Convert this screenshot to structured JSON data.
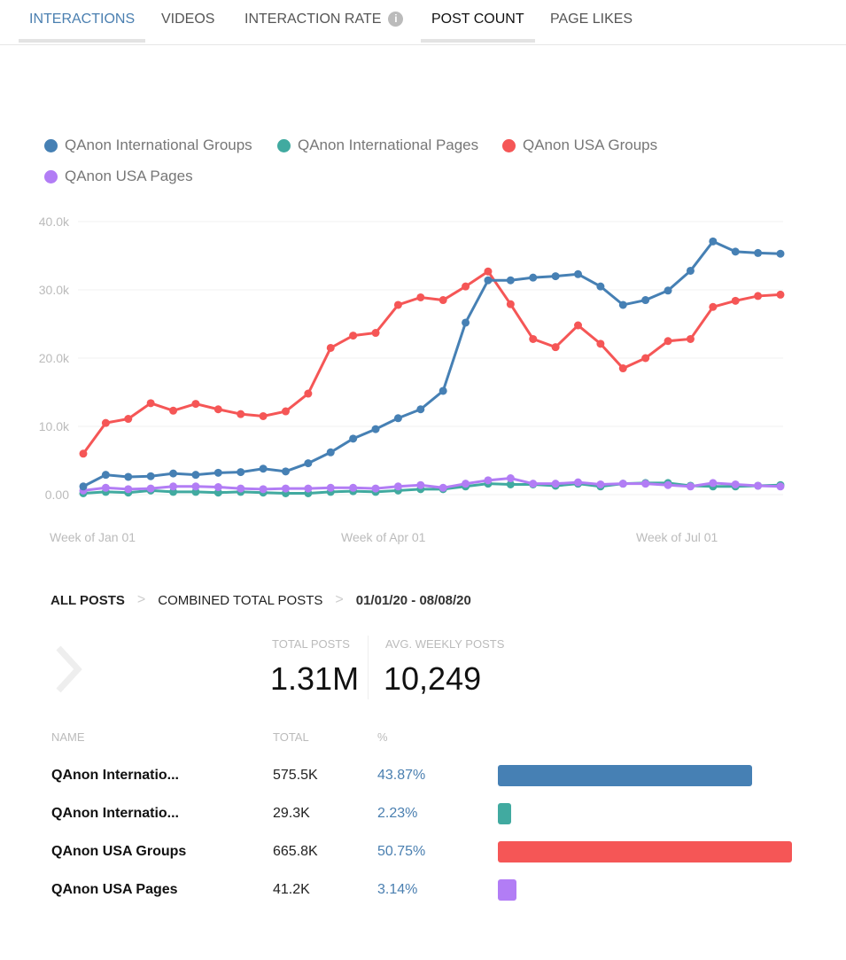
{
  "tabs": [
    {
      "label": "INTERACTIONS"
    },
    {
      "label": "VIDEOS"
    },
    {
      "label": "INTERACTION RATE",
      "icon": "info-icon",
      "icon_glyph": "i"
    },
    {
      "label": "POST COUNT"
    },
    {
      "label": "PAGE LIKES"
    }
  ],
  "active_tab": "POST COUNT",
  "chart_data": {
    "type": "line",
    "legend_placement": "top-left",
    "grid": true,
    "ylim": [
      0,
      40000
    ],
    "y_ticks": [
      "0.00",
      "10.0k",
      "20.0k",
      "30.0k",
      "40.0k"
    ],
    "x_tick_labels": [
      "Week of Jan 01",
      "Week of Apr 01",
      "Week of Jul 01"
    ],
    "x": [
      "2020-01-01",
      "2020-01-08",
      "2020-01-15",
      "2020-01-22",
      "2020-01-29",
      "2020-02-05",
      "2020-02-12",
      "2020-02-19",
      "2020-02-26",
      "2020-03-04",
      "2020-03-11",
      "2020-03-18",
      "2020-03-25",
      "2020-04-01",
      "2020-04-08",
      "2020-04-15",
      "2020-04-22",
      "2020-04-29",
      "2020-05-06",
      "2020-05-13",
      "2020-05-20",
      "2020-05-27",
      "2020-06-03",
      "2020-06-10",
      "2020-06-17",
      "2020-06-24",
      "2020-07-01",
      "2020-07-08",
      "2020-07-15",
      "2020-07-22",
      "2020-07-29",
      "2020-08-05"
    ],
    "series": [
      {
        "name": "QAnon International Groups",
        "color": "#4680b4",
        "values": [
          1200,
          2900,
          2600,
          2700,
          3100,
          2900,
          3200,
          3300,
          3800,
          3400,
          4600,
          6200,
          8200,
          9600,
          11200,
          12500,
          15200,
          25200,
          31400,
          31400,
          31800,
          32000,
          32300,
          30500,
          27800,
          28500,
          29900,
          32800,
          37100,
          35600,
          35400,
          35300
        ]
      },
      {
        "name": "QAnon International Pages",
        "color": "#41aaa0",
        "values": [
          200,
          400,
          300,
          600,
          400,
          400,
          300,
          400,
          300,
          200,
          200,
          400,
          500,
          400,
          600,
          800,
          800,
          1200,
          1600,
          1500,
          1500,
          1300,
          1600,
          1200,
          1600,
          1700,
          1700,
          1300,
          1200,
          1200,
          1300,
          1400
        ]
      },
      {
        "name": "QAnon USA Groups",
        "color": "#f55656",
        "values": [
          6000,
          10500,
          11100,
          13400,
          12300,
          13300,
          12500,
          11800,
          11500,
          12200,
          14800,
          21500,
          23300,
          23700,
          27800,
          28900,
          28500,
          30500,
          32700,
          27900,
          22800,
          21600,
          24800,
          22100,
          18500,
          20000,
          22500,
          22800,
          27500,
          28400,
          29100,
          29300
        ]
      },
      {
        "name": "QAnon USA Pages",
        "color": "#b27df5",
        "values": [
          600,
          1000,
          800,
          900,
          1200,
          1200,
          1100,
          900,
          800,
          900,
          900,
          1000,
          1000,
          900,
          1200,
          1400,
          1000,
          1600,
          2100,
          2400,
          1600,
          1600,
          1800,
          1500,
          1600,
          1600,
          1400,
          1200,
          1700,
          1500,
          1300,
          1200
        ]
      }
    ]
  },
  "breadcrumb": {
    "items": [
      "ALL POSTS",
      "COMBINED TOTAL POSTS"
    ],
    "date_range": "01/01/20 - 08/08/20"
  },
  "stats": {
    "total_label": "TOTAL POSTS",
    "total_value": "1.31M",
    "avg_label": "AVG. WEEKLY POSTS",
    "avg_value": "10,249"
  },
  "table": {
    "headers": [
      "NAME",
      "TOTAL",
      "%"
    ],
    "rows": [
      {
        "name": "QAnon Internatio...",
        "total": "575.5K",
        "pct": "43.87%",
        "pct_value": 43.87,
        "color": "#4680b4"
      },
      {
        "name": "QAnon Internatio...",
        "total": "29.3K",
        "pct": "2.23%",
        "pct_value": 2.23,
        "color": "#41aaa0"
      },
      {
        "name": "QAnon USA Groups",
        "total": "665.8K",
        "pct": "50.75%",
        "pct_value": 50.75,
        "color": "#f55656"
      },
      {
        "name": "QAnon USA Pages",
        "total": "41.2K",
        "pct": "3.14%",
        "pct_value": 3.14,
        "color": "#b27df5"
      }
    ]
  }
}
